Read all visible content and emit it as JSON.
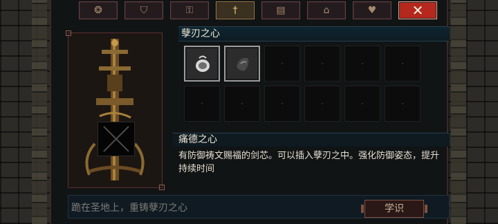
{
  "tabs": [
    {
      "name": "tab-coins",
      "icon": "coins-icon",
      "glyph": "❂"
    },
    {
      "name": "tab-helmet",
      "icon": "helmet-icon",
      "glyph": "⛉"
    },
    {
      "name": "tab-key",
      "icon": "key-icon",
      "glyph": "⚿"
    },
    {
      "name": "tab-sword",
      "icon": "sword-icon",
      "glyph": "†",
      "active": true
    },
    {
      "name": "tab-book",
      "icon": "book-icon",
      "glyph": "▤"
    },
    {
      "name": "tab-altar",
      "icon": "altar-icon",
      "glyph": "⌂"
    },
    {
      "name": "tab-hearts",
      "icon": "hearts-icon",
      "glyph": "♥"
    }
  ],
  "close_glyph": "✕",
  "grid": {
    "title": "孽刃之心",
    "slots_total": 12,
    "filled": [
      {
        "icon": "tear-pouch-icon",
        "selected": true
      },
      {
        "icon": "dark-heart-icon",
        "selected": false
      }
    ]
  },
  "description": {
    "title": "痛德之心",
    "text": "有防御祷文赐福的剑芯。可以插入孽刃之中。强化防御姿态，提升持续时间"
  },
  "bottom": {
    "hint": "跪在圣地上，重铸孽刃之心",
    "button_label": "学识"
  },
  "colors": {
    "accent_gold": "#a07f3c",
    "close_red": "#b5281e",
    "panel_bg": "#111415"
  }
}
